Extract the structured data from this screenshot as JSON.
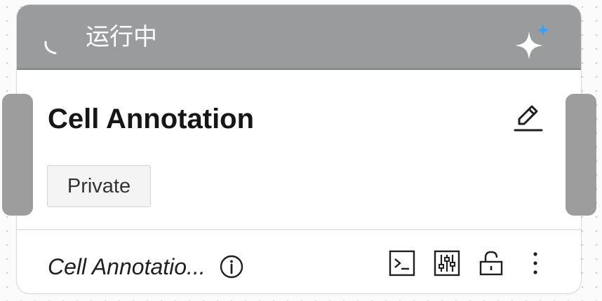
{
  "status": {
    "text": "运行中",
    "bar_color": "#9a9b9c",
    "icons": {
      "spinner": "spinner-icon",
      "ai": "sparkle-icon"
    }
  },
  "card": {
    "title": "Cell Annotation",
    "tag": "Private",
    "edit_icon": "pencil-edit-icon"
  },
  "footer": {
    "name": "Cell Annotatio...",
    "icons": [
      "info-icon",
      "terminal-icon",
      "sliders-icon",
      "lock-icon",
      "more-vertical-icon"
    ]
  },
  "colors": {
    "accent_blue": "#3aa0ff",
    "text": "#161616"
  }
}
